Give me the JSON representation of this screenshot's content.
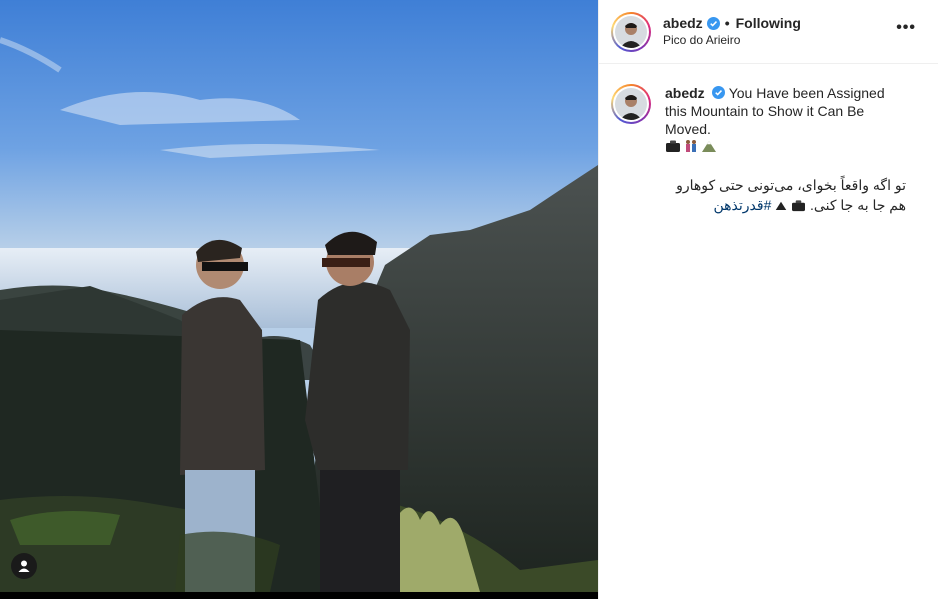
{
  "post": {
    "author": {
      "username": "abedz",
      "verified": true,
      "follow_status": "Following",
      "location": "Pico do Arieiro"
    },
    "caption": {
      "text": "You Have been Assigned this Mountain to Show it Can Be Moved.",
      "emojis": [
        "camera-bag-icon",
        "two-people-icon",
        "mountain-icon"
      ],
      "persian_text": "تو اگه واقعاً بخوای، می‌تونی حتی کوهارو هم جا به جا کنی.",
      "persian_emojis": [
        "camera-bag-icon",
        "mountain-icon"
      ],
      "hashtag": "#قدرتذهن"
    },
    "more_label": "•••",
    "media": {
      "description_icon": "user-tag-icon"
    }
  },
  "colors": {
    "verified": "#3897f0",
    "hashtag": "#00376b",
    "border": "#efefef"
  }
}
